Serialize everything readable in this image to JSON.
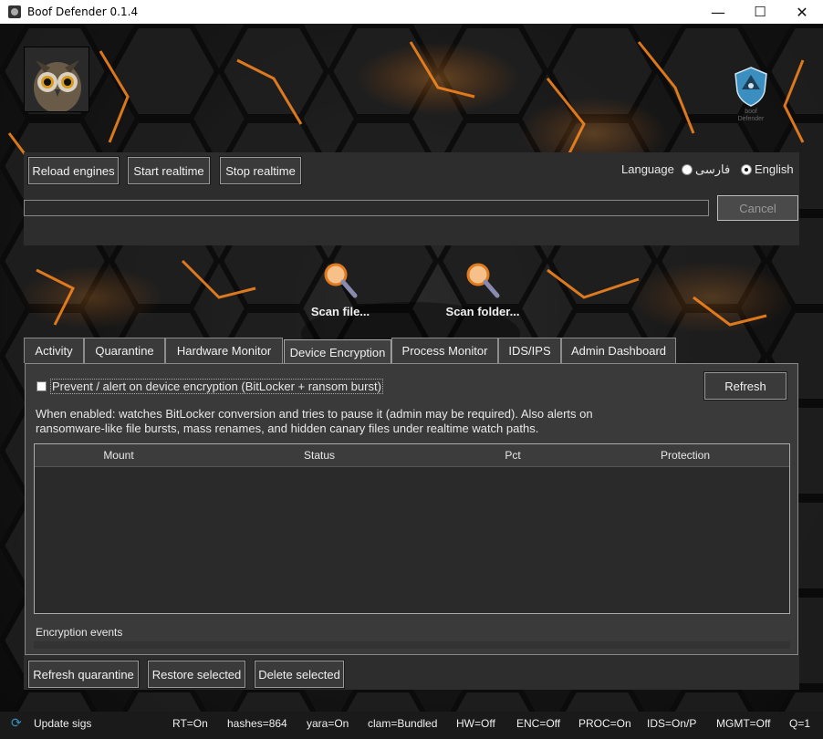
{
  "window": {
    "title": "Boof Defender 0.1.4",
    "minimize": "—",
    "maximize": "☐",
    "close": "✕"
  },
  "toolbar": {
    "reload": "Reload engines",
    "start": "Start realtime",
    "stop": "Stop realtime",
    "language_label": "Language",
    "lang_fa": "فارسی",
    "lang_en": "English",
    "selected_language": "English"
  },
  "progress": {
    "value": 0,
    "cancel": "Cancel"
  },
  "scan": {
    "file": "Scan file...",
    "folder": "Scan folder..."
  },
  "watermark": {
    "line1": "boof",
    "line2": "Defender"
  },
  "tabs": [
    {
      "label": "Activity"
    },
    {
      "label": "Quarantine"
    },
    {
      "label": "Hardware Monitor"
    },
    {
      "label": "Device Encryption",
      "active": true
    },
    {
      "label": "Process Monitor"
    },
    {
      "label": "IDS/IPS"
    },
    {
      "label": "Admin Dashboard"
    }
  ],
  "encryption": {
    "checkbox_label": "Prevent / alert on device encryption (BitLocker + ransom burst)",
    "checked": false,
    "refresh": "Refresh",
    "description": "When enabled: watches BitLocker conversion and tries to pause it (admin may be required). Also alerts on ransomware-like file bursts, mass renames, and hidden canary files under realtime watch paths.",
    "columns": [
      "Mount",
      "Status",
      "Pct",
      "Protection"
    ],
    "rows": [],
    "events_label": "Encryption events"
  },
  "bottom": {
    "refresh_quarantine": "Refresh quarantine",
    "restore": "Restore selected",
    "delete": "Delete selected"
  },
  "status": {
    "update": "Update sigs",
    "rt": "RT=On",
    "hashes": "hashes=864",
    "yara": "yara=On",
    "clam": "clam=Bundled",
    "hw": "HW=Off",
    "enc": "ENC=Off",
    "proc": "PROC=On",
    "ids": "IDS=On/P",
    "mgmt": "MGMT=Off",
    "q": "Q=1"
  },
  "colors": {
    "accent_orange": "#ff8a1e",
    "panel": "#2d2d2d",
    "shield_blue": "#3b8fc0"
  }
}
